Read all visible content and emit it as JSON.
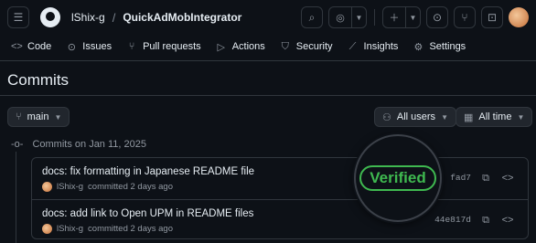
{
  "header": {
    "owner": "lShix-g",
    "separator": "/",
    "repo": "QuickAdMobIntegrator",
    "icons": [
      "hamburger-icon",
      "github-logo",
      "search-icon",
      "copilot-icon",
      "plus-icon",
      "issue-icon",
      "pull-request-icon",
      "inbox-icon"
    ]
  },
  "tabs": [
    {
      "label": "Code",
      "icon": "<>"
    },
    {
      "label": "Issues",
      "icon": "⊙"
    },
    {
      "label": "Pull requests",
      "icon": "⑂"
    },
    {
      "label": "Actions",
      "icon": "▷"
    },
    {
      "label": "Security",
      "icon": "⛉"
    },
    {
      "label": "Insights",
      "icon": "⟋"
    },
    {
      "label": "Settings",
      "icon": "⚙"
    }
  ],
  "page": {
    "title": "Commits"
  },
  "filters": {
    "branch": "main",
    "users": "All users",
    "time": "All time"
  },
  "group": {
    "date_label": "Commits on Jan 11, 2025"
  },
  "commits": [
    {
      "title": "docs: fix formatting in Japanese README file",
      "author": "lShix-g",
      "meta": "committed 2 days ago",
      "sha": "fad7",
      "badge": "Verified"
    },
    {
      "title": "docs: add link to Open UPM in README files",
      "author": "lShix-g",
      "meta": "committed 2 days ago",
      "sha": "44e817d"
    }
  ],
  "colors": {
    "background": "#0d1117",
    "border": "#30363d",
    "verified": "#3fb950"
  }
}
